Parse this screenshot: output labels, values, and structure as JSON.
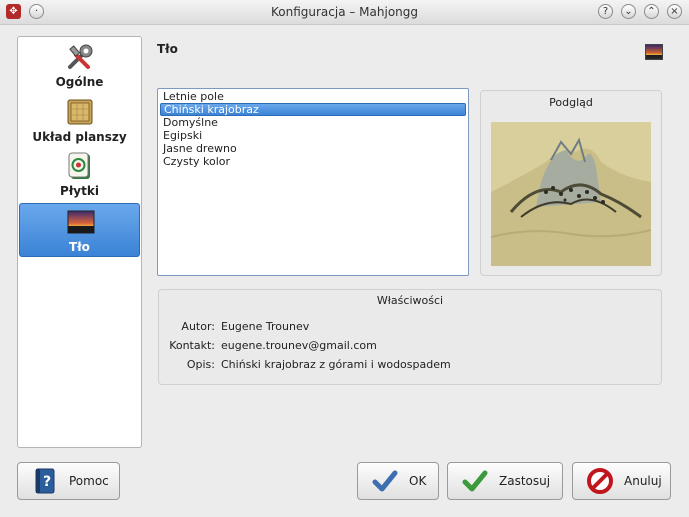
{
  "window": {
    "title": "Konfiguracja – Mahjongg"
  },
  "sidebar": {
    "items": [
      {
        "label": "Ogólne",
        "icon": "tools-icon"
      },
      {
        "label": "Układ planszy",
        "icon": "board-tile-icon"
      },
      {
        "label": "Płytki",
        "icon": "mahjong-tile-icon"
      },
      {
        "label": "Tło",
        "icon": "background-landscape-icon",
        "selected": true
      }
    ]
  },
  "page": {
    "title": "Tło"
  },
  "background_list": {
    "items": [
      "Letnie pole",
      "Chiński krajobraz",
      "Domyślne",
      "Egipski",
      "Jasne drewno",
      "Czysty kolor"
    ],
    "selected": "Chiński krajobraz"
  },
  "preview": {
    "label": "Podgląd"
  },
  "properties": {
    "header": "Właściwości",
    "author_label": "Autor:",
    "author": "Eugene Trounev",
    "contact_label": "Kontakt:",
    "contact": "eugene.trounev@gmail.com",
    "description_label": "Opis:",
    "description": "Chiński krajobraz z górami i wodospadem"
  },
  "buttons": {
    "help": "Pomoc",
    "ok": "OK",
    "apply": "Zastosuj",
    "cancel": "Anuluj"
  },
  "colors": {
    "selection": "#3b83d6",
    "window_bg": "#ececec"
  }
}
